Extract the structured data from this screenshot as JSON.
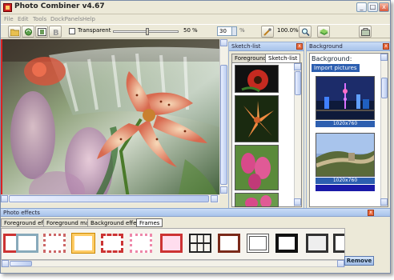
{
  "window": {
    "title": "Photo Combiner v4.67"
  },
  "menu": [
    "File",
    "Edit",
    "Tools",
    "DockPanels",
    "Help"
  ],
  "toolbar": {
    "transparent_label": "Transparent",
    "transparency_value": "50",
    "transparency_unit": "%",
    "size_value": "30",
    "zoom_value": "100.0%"
  },
  "sketch_panel": {
    "title": "Sketch-list",
    "tabs": [
      "Foreground",
      "Sketch-list"
    ],
    "active_tab": "Sketch-list"
  },
  "background_panel": {
    "title": "Background",
    "heading": "Background:",
    "import_button": "Import pictures",
    "items": [
      {
        "caption": "1020x760"
      },
      {
        "caption": "1020x760"
      }
    ]
  },
  "effects_panel": {
    "title": "Photo effects",
    "tabs": [
      "Foreground effect",
      "Foreground mask",
      "Background effect",
      "Frames"
    ],
    "active_tab": "Frames",
    "remove_button": "Remove"
  },
  "colors": {
    "accent": "#2d5fb0",
    "panel_header": "#a8c3ea",
    "window_bg": "#ece9d8"
  }
}
